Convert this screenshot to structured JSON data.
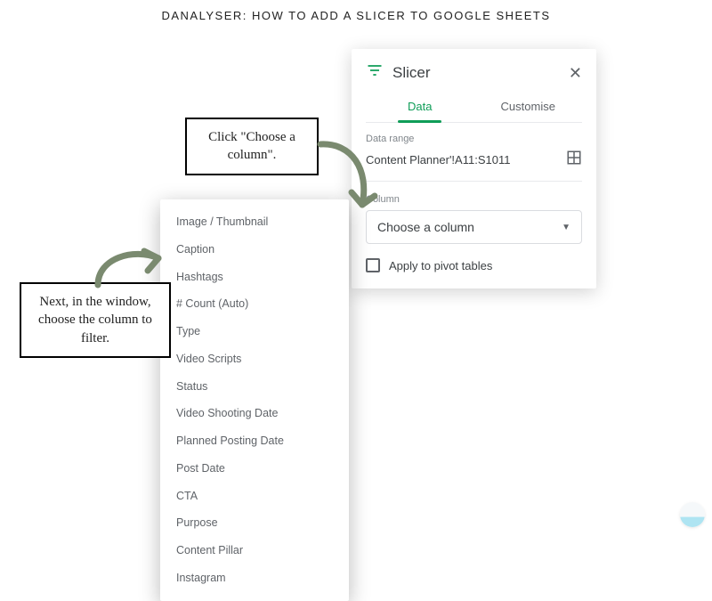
{
  "title": "DANALYSER: HOW TO ADD A SLICER TO GOOGLE SHEETS",
  "slicer": {
    "title": "Slicer",
    "tabs": {
      "data": "Data",
      "customise": "Customise"
    },
    "labels": {
      "range": "Data range",
      "column": "Column"
    },
    "range_value": "Content Planner'!A11:S1011",
    "dropdown_placeholder": "Choose a column",
    "checkbox_label": "Apply to pivot tables"
  },
  "columns": [
    "Image / Thumbnail",
    "Caption",
    "Hashtags",
    "# Count (Auto)",
    "Type",
    "Video Scripts",
    "Status",
    "Video Shooting Date",
    "Planned Posting Date",
    "Post Date",
    "CTA",
    "Purpose",
    "Content Pillar",
    "Instagram"
  ],
  "callouts": {
    "step1": "Click \"Choose a column\".",
    "step2": "Next, in the window, choose the column to filter."
  }
}
